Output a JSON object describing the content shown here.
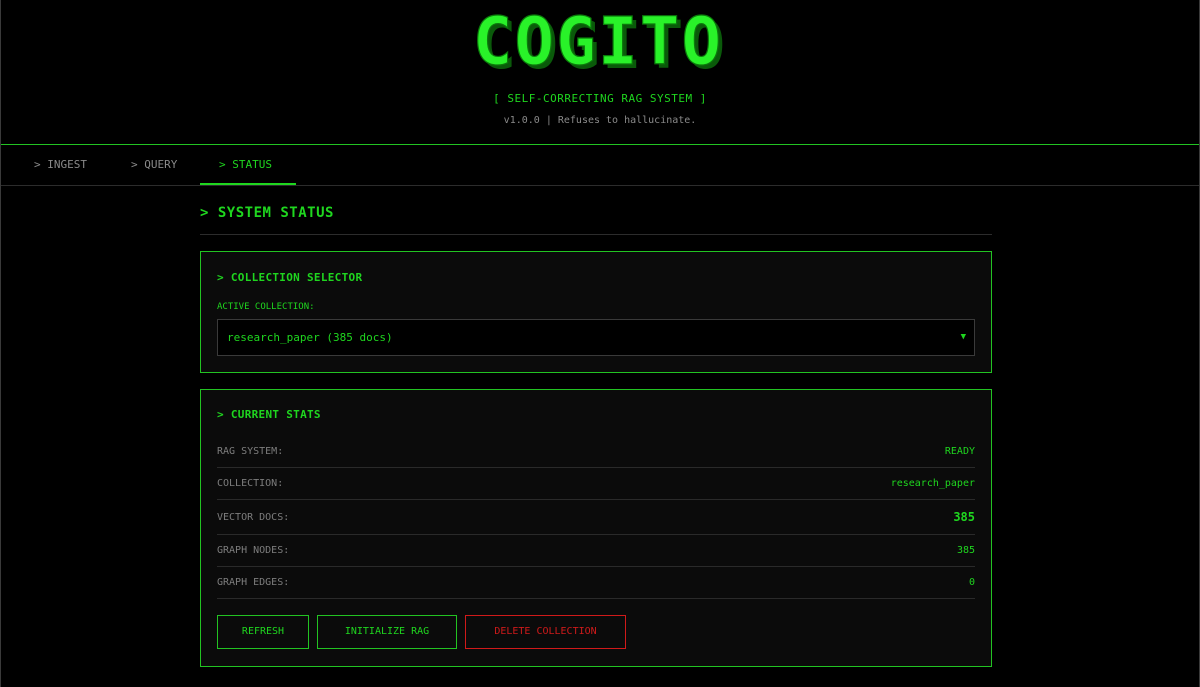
{
  "header": {
    "logo": "COGITO",
    "subtitle": "[ SELF-CORRECTING RAG SYSTEM ]",
    "version": "v1.0.0 | Refuses to hallucinate."
  },
  "nav": {
    "tabs": [
      {
        "label": "> INGEST"
      },
      {
        "label": "> QUERY"
      },
      {
        "label": "> STATUS"
      }
    ],
    "active": "> STATUS"
  },
  "main": {
    "title": "> SYSTEM STATUS",
    "collection_panel": {
      "title": "> COLLECTION SELECTOR",
      "field_label": "ACTIVE COLLECTION:",
      "selected": "research_paper (385 docs)"
    },
    "stats_panel": {
      "title": "> CURRENT STATS",
      "rows": [
        {
          "label": "RAG SYSTEM:",
          "value": "READY"
        },
        {
          "label": "COLLECTION:",
          "value": "research_paper"
        },
        {
          "label": "VECTOR DOCS:",
          "value": "385"
        },
        {
          "label": "GRAPH NODES:",
          "value": "385"
        },
        {
          "label": "GRAPH EDGES:",
          "value": "0"
        }
      ],
      "buttons": {
        "refresh": "REFRESH",
        "initialize": "INITIALIZE RAG",
        "delete": "DELETE COLLECTION"
      }
    }
  },
  "colors": {
    "accent": "#1fd61f",
    "danger": "#d01a1a",
    "background": "#000000",
    "panel": "#0b0b0b"
  }
}
